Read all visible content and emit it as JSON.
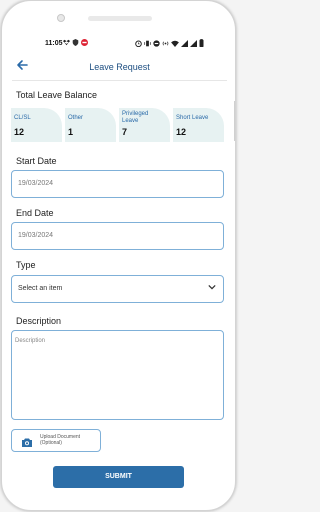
{
  "status_bar": {
    "time": "11:05",
    "left_icons": [
      "dropbox-icon",
      "shield-icon",
      "record-icon"
    ],
    "right_icons": [
      "alarm-icon",
      "vibrate-icon",
      "dnd-icon",
      "hotspot-icon",
      "wifi-icon",
      "signal-icon",
      "signal-icon",
      "battery-icon"
    ]
  },
  "header": {
    "title": "Leave Request",
    "back_icon": "arrow-left-icon"
  },
  "balance": {
    "heading": "Total Leave Balance",
    "cards": [
      {
        "label": "CL/SL",
        "value": "12"
      },
      {
        "label": "Other",
        "value": "1"
      },
      {
        "label": "Privileged\nLeave",
        "value": "7"
      },
      {
        "label": "Short Leave",
        "value": "12"
      }
    ]
  },
  "form": {
    "start_label": "Start Date",
    "start_value": "19/03/2024",
    "end_label": "End Date",
    "end_value": "19/03/2024",
    "type_label": "Type",
    "type_value": "Select an item",
    "description_label": "Description",
    "description_placeholder": "Description",
    "upload_label": "Upload Document",
    "upload_optional": "(Optional)",
    "submit_label": "SUBMIT"
  },
  "colors": {
    "accent": "#2c6ea8",
    "card_bg": "#e7f2f2",
    "border": "#7fb0d8"
  }
}
